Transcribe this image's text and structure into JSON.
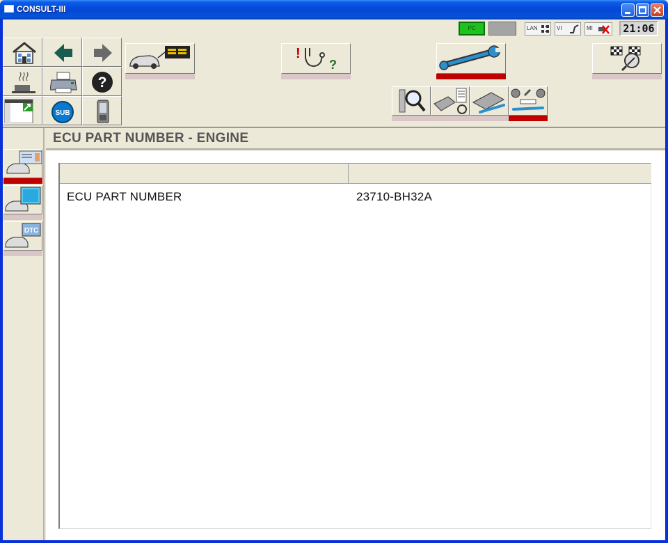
{
  "window": {
    "title": "CONSULT-III"
  },
  "status": {
    "pc_label": "PC",
    "lan_label": "LAN",
    "vi_label": "VI",
    "mi_label": "MI",
    "clock": "21:06"
  },
  "toolbar": {
    "grid_buttons": [
      {
        "name": "home-button",
        "icon": "house-icon"
      },
      {
        "name": "back-button",
        "icon": "arrow-left-icon"
      },
      {
        "name": "forward-button",
        "icon": "arrow-right-icon"
      },
      {
        "name": "sleep-button",
        "icon": "coffee-cup-icon"
      },
      {
        "name": "print-button",
        "icon": "printer-icon"
      },
      {
        "name": "help-button",
        "icon": "question-icon"
      },
      {
        "name": "screen-capture-button",
        "icon": "window-arrow-icon"
      },
      {
        "name": "sub-button",
        "icon": "sub-icon",
        "label": "SUB"
      },
      {
        "name": "handheld-button",
        "icon": "device-icon"
      }
    ],
    "big_buttons": [
      {
        "name": "diagnosis-all-systems-button",
        "icon": "car-monitor-icon",
        "active": false
      },
      {
        "name": "diagnosis-stethoscope-button",
        "icon": "stethoscope-icon",
        "active": false
      },
      {
        "name": "repair-wrench-button",
        "icon": "wrench-icon",
        "active": true
      },
      {
        "name": "settings-flags-button",
        "icon": "checkered-flags-icon",
        "active": false
      }
    ],
    "sub_buttons": [
      {
        "name": "work-support-button",
        "icon": "magnifier-icon",
        "active": false
      },
      {
        "name": "ecu-reprogram-button",
        "icon": "ecu-data-icon",
        "active": false
      },
      {
        "name": "ecu-replace-button",
        "icon": "ecu-wrench-icon",
        "active": false
      },
      {
        "name": "ecu-part-number-button",
        "icon": "gears-icon",
        "active": true
      }
    ]
  },
  "side_tabs": [
    {
      "name": "ecu-identification-tab",
      "icon": "car-id-icon",
      "active": true
    },
    {
      "name": "data-monitor-tab",
      "icon": "car-monitor-icon",
      "active": false
    },
    {
      "name": "dtc-tab",
      "icon": "dtc-icon",
      "active": false,
      "label": "DTC"
    }
  ],
  "main": {
    "title": "ECU PART NUMBER - ENGINE",
    "table": {
      "headers": [
        "",
        ""
      ],
      "rows": [
        {
          "label": "ECU PART NUMBER",
          "value": "23710-BH32A"
        }
      ]
    }
  },
  "colors": {
    "active_bar": "#c00000",
    "inactive_bar": "#d9c6c6",
    "title_bar": "#0546d6",
    "face": "#ece9d8"
  }
}
